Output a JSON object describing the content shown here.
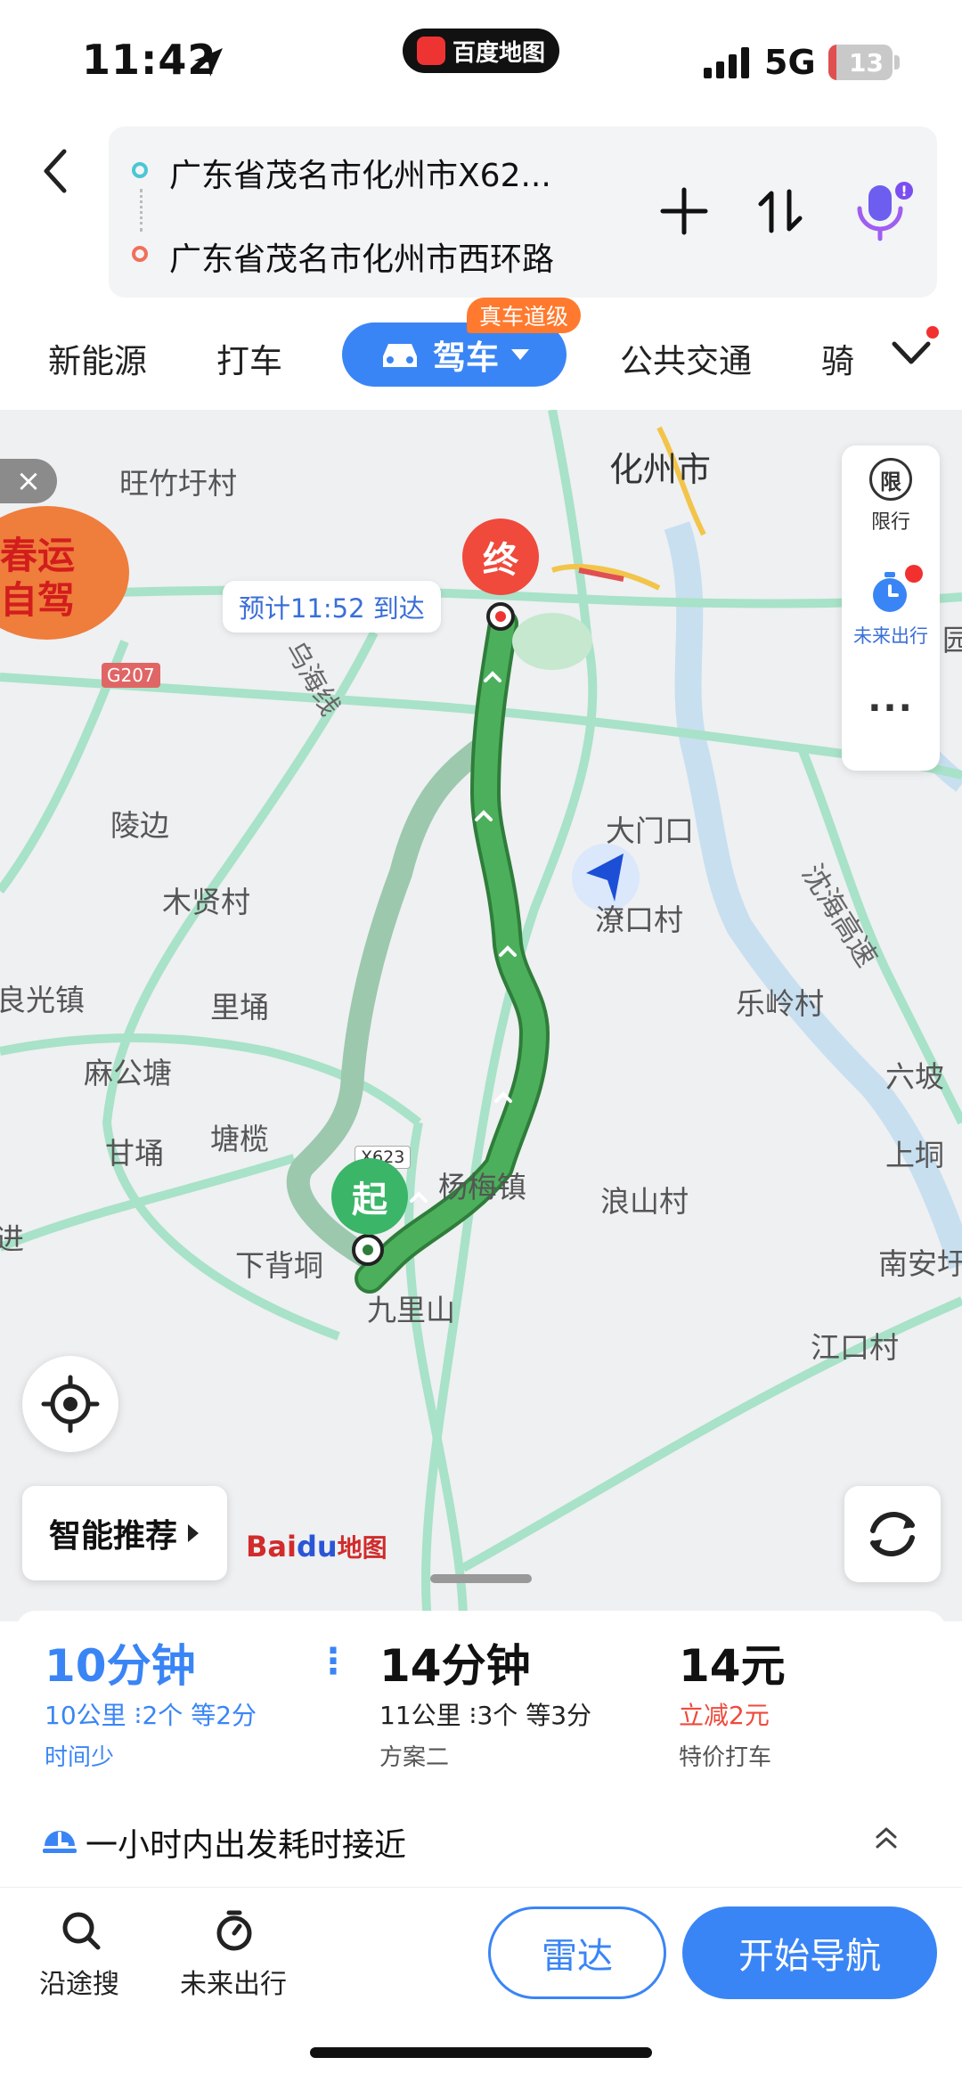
{
  "status": {
    "time": "11:42",
    "app_pill": "百度地图",
    "network": "5G",
    "battery": "13",
    "battery_level": 0.13
  },
  "route": {
    "origin": "广东省茂名市化州市X62...",
    "destination": "广东省茂名市化州市西环路"
  },
  "tabs": [
    {
      "label": "新能源"
    },
    {
      "label": "打车"
    },
    {
      "label": "驾车",
      "active": true
    },
    {
      "label": "公共交通"
    },
    {
      "label": "骑"
    }
  ],
  "drive_tag": "真车道级",
  "map": {
    "eta": "预计11:52 到达",
    "start_pin": "起",
    "end_pin": "终",
    "side_limit": "限行",
    "side_limit_icon": "限",
    "side_future": "未来出行",
    "side_more": "...",
    "labels": {
      "huazhou": "化州市",
      "wangzhu": "旺竹圩村",
      "wuhai": "乌海线",
      "lingbian": "陵边",
      "damenkou": "大门口",
      "muxian": "木贤村",
      "liaokou": "潦口村",
      "g207": "G207",
      "liangguang": "良光镇",
      "liyong": "里埇",
      "lelingcun": "乐岭村",
      "magongtang": "麻公塘",
      "liupo": "六坡",
      "tanglan": "塘榄",
      "ganyong": "甘埇",
      "x623": "X623",
      "yangmei": "杨梅镇",
      "langshan": "浪山村",
      "shanghe": "上垌",
      "chenhai": "沈海高速",
      "xiabeidong": "下背垌",
      "jiulishan": "九里山",
      "nananxu": "南安圩",
      "jiangkoucun": "江口村",
      "yuan": "园",
      "zhuan": "进"
    },
    "promo_line1": "春运",
    "promo_line2": "自驾",
    "close": "×",
    "smart_recommend": "智能推荐",
    "baidu_logo_text": "Bai",
    "baidu_logo_paw": "du",
    "baidu_logo_suffix": "地图"
  },
  "route_options": [
    {
      "time": "10分钟",
      "distance": "10公里",
      "lights": "2个",
      "wait": "等2分",
      "note": "时间少",
      "selected": true
    },
    {
      "time": "14分钟",
      "distance": "11公里",
      "lights": "3个",
      "wait": "等3分",
      "note": "方案二"
    },
    {
      "time": "14元",
      "discount": "立减2元",
      "note": "特价打车"
    }
  ],
  "tip": "一小时内出发耗时接近",
  "bottom": {
    "search_along": "沿途搜",
    "future_trip": "未来出行",
    "radar": "雷达",
    "start_nav": "开始导航"
  },
  "colors": {
    "accent": "#3a85f5",
    "route_main": "#4caf5c",
    "route_alt": "#9cc8ae",
    "orange": "#ff7a2e",
    "red": "#f23030"
  }
}
